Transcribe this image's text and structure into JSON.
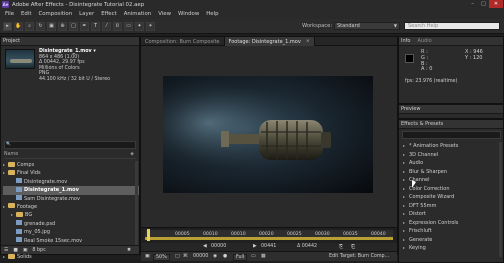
{
  "window": {
    "app_icon": "Ae",
    "title": "Adobe After Effects - Disintegrate Tutorial 02.aep",
    "controls": [
      "–",
      "□",
      "✕"
    ]
  },
  "menu": [
    "File",
    "Edit",
    "Composition",
    "Layer",
    "Effect",
    "Animation",
    "View",
    "Window",
    "Help"
  ],
  "toolbar": {
    "tools": [
      "selection-tool-icon",
      "hand-tool-icon",
      "zoom-tool-icon",
      "rotate-tool-icon",
      "camera-tool-icon",
      "pan-behind-tool-icon",
      "rectangle-tool-icon",
      "pen-tool-icon",
      "type-tool-icon",
      "brush-tool-icon",
      "clone-stamp-tool-icon",
      "eraser-tool-icon",
      "roto-brush-tool-icon",
      "puppet-tool-icon"
    ],
    "workspace_label": "Workspace:",
    "workspace_value": "Standard",
    "search_placeholder": "Search Help"
  },
  "project": {
    "tab": "Project",
    "file_name": "Disintegrate_1.mov ▾",
    "file_dims": "864 x 486 (1.00)",
    "file_duration": "Δ 00442, 29.97 fps",
    "file_colors": "Millions of Colors",
    "file_codec": "PNG",
    "file_audio": "44.100 kHz / 32 bit U / Stereo",
    "column_name": "Name",
    "tree": [
      {
        "label": "Comps",
        "kind": "folder",
        "indent": 0,
        "selected": false
      },
      {
        "label": "Final Vids",
        "kind": "folder",
        "indent": 0,
        "selected": false
      },
      {
        "label": "Disintegrate.mov",
        "kind": "file",
        "indent": 1,
        "selected": false
      },
      {
        "label": "Disintegrate_1.mov",
        "kind": "file",
        "indent": 1,
        "selected": true
      },
      {
        "label": "Sam Disintegrate.mov",
        "kind": "file",
        "indent": 1,
        "selected": false
      },
      {
        "label": "Footage",
        "kind": "folder",
        "indent": 0,
        "selected": false
      },
      {
        "label": "BG",
        "kind": "folder",
        "indent": 1,
        "selected": false
      },
      {
        "label": "grenade.psd",
        "kind": "file",
        "indent": 1,
        "selected": false
      },
      {
        "label": "my_05.jpg",
        "kind": "file",
        "indent": 1,
        "selected": false
      },
      {
        "label": "Real Smoke 15sec.mov",
        "kind": "file",
        "indent": 1,
        "selected": false
      },
      {
        "label": "Sam GS",
        "kind": "folder",
        "indent": 1,
        "selected": false
      },
      {
        "label": "Solids",
        "kind": "folder",
        "indent": 0,
        "selected": false
      }
    ],
    "footer_bpc": "8 bpc"
  },
  "viewer": {
    "tabs": [
      {
        "label": "Composition: Burn Composite",
        "active": false
      },
      {
        "label": "Footage: Disintegrate_1.mov",
        "active": true
      }
    ],
    "tab_close": "×",
    "ruler": [
      "00000",
      "00005",
      "00010",
      "00020",
      "00025",
      "00030",
      "00035",
      "00040"
    ],
    "current_time": "00000",
    "out_time": "00441",
    "duration": "Δ 00442",
    "zoom": "50%",
    "view_time": "00000",
    "view_mode": "Full",
    "edit_target": "Edit Target: Burn Comp..."
  },
  "info": {
    "tabs": [
      "Info",
      "Audio"
    ],
    "r": "R :",
    "g": "G :",
    "b": "B :",
    "a": "A : 0",
    "x": "X : 946",
    "y": "Y : 120",
    "fps": "fps: 23.976 (realtime)"
  },
  "preview": {
    "tab": "Preview"
  },
  "effects": {
    "tab": "Effects & Presets",
    "list": [
      "* Animation Presets",
      "3D Channel",
      "Audio",
      "Blur & Sharpen",
      "Channel",
      "Color Correction",
      "Composite Wizard",
      "DFT 55mm",
      "Distort",
      "Expression Controls",
      "Frischluft",
      "Generate",
      "Keying"
    ]
  }
}
